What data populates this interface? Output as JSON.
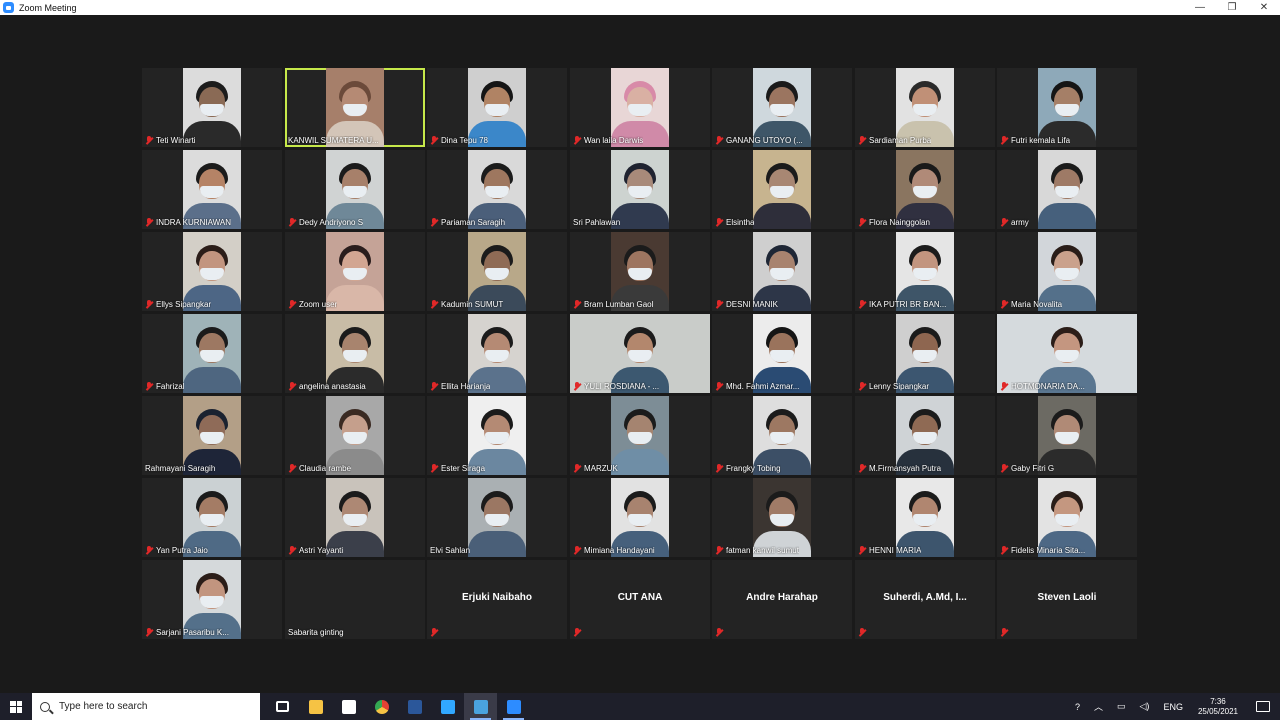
{
  "window": {
    "title": "Zoom Meeting",
    "minimize": "—",
    "maximize": "❐",
    "close": "✕"
  },
  "participants": [
    {
      "name": "Teti Winarti",
      "muted": true,
      "video": true,
      "bg": "#dcdcdc",
      "skin": "#8a6a55",
      "hair": "#1c1c1c",
      "body": "#2a2a2a"
    },
    {
      "name": "KANWIL SUMATERA U...",
      "muted": false,
      "video": true,
      "active": true,
      "bg": "#a67f6a",
      "skin": "#b58a74",
      "hair": "#6b4a3a",
      "body": "#d3c5b8"
    },
    {
      "name": "Dina Tepu 78",
      "muted": true,
      "video": true,
      "bg": "#cfcfcf",
      "skin": "#b08364",
      "hair": "#151515",
      "body": "#3b87c9"
    },
    {
      "name": "Wan laila Darwis",
      "muted": true,
      "video": true,
      "bg": "#e8d6d6",
      "skin": "#d9b0a3",
      "hair": "#d88aa8",
      "body": "#d08aa8"
    },
    {
      "name": "GANANG UTOYO (...",
      "muted": true,
      "video": true,
      "bg": "#cfd8dd",
      "skin": "#9b7560",
      "hair": "#1a1a1a",
      "body": "#3e5668"
    },
    {
      "name": "Sardiaman Purba",
      "muted": true,
      "video": true,
      "bg": "#e2e2e2",
      "skin": "#c09077",
      "hair": "#2a2a2a",
      "body": "#c9c2ad"
    },
    {
      "name": "Futri kemala Lifa",
      "muted": true,
      "video": true,
      "bg": "#8ea9b9",
      "skin": "#a57f67",
      "hair": "#151515",
      "body": "#2b2b2b"
    },
    {
      "name": "INDRA KURNIAWAN",
      "muted": true,
      "video": true,
      "bg": "#dcdcdc",
      "skin": "#b58366",
      "hair": "#1b1b1b",
      "body": "#5b6f8a"
    },
    {
      "name": "Dedy Andriyono S",
      "muted": true,
      "video": true,
      "bg": "#d0d3d3",
      "skin": "#a7806a",
      "hair": "#1b1b1b",
      "body": "#6f8898"
    },
    {
      "name": "Pariaman Saragih",
      "muted": true,
      "video": true,
      "bg": "#d9d9d9",
      "skin": "#9e775f",
      "hair": "#1b1b1b",
      "body": "#4b5f7a"
    },
    {
      "name": "Sri Pahlawan",
      "muted": false,
      "video": true,
      "bg": "#cdd3d0",
      "skin": "#a88a7a",
      "hair": "#1f2330",
      "body": "#303a4f"
    },
    {
      "name": "Elsintha",
      "muted": true,
      "video": true,
      "bg": "#c7b48f",
      "skin": "#a88773",
      "hair": "#1b1b1b",
      "body": "#2e2e3a"
    },
    {
      "name": "Flora Nainggolan",
      "muted": true,
      "video": true,
      "bg": "#8a7560",
      "skin": "#b08a78",
      "hair": "#1a1a1a",
      "body": "#303040"
    },
    {
      "name": "army",
      "muted": true,
      "video": true,
      "bg": "#d8d8d8",
      "skin": "#9e7a66",
      "hair": "#1b1b1b",
      "body": "#46607c"
    },
    {
      "name": "Ellys Sipangkar",
      "muted": true,
      "video": true,
      "bg": "#d3cfc7",
      "skin": "#c2957f",
      "hair": "#2b1d18",
      "body": "#4d6685"
    },
    {
      "name": "Zoom user",
      "muted": true,
      "video": true,
      "bg": "#c5a397",
      "skin": "#d2a692",
      "hair": "#2a1d1c",
      "body": "#d9b7a8"
    },
    {
      "name": "Kadumin SUMUT",
      "muted": true,
      "video": true,
      "bg": "#b8a889",
      "skin": "#8f6b55",
      "hair": "#1b1b1b",
      "body": "#3b4a5a"
    },
    {
      "name": "Bram Lumban Gaol",
      "muted": true,
      "video": true,
      "bg": "#4a3a32",
      "skin": "#9d7560",
      "hair": "#1b1b1b",
      "body": "#3a3a3a"
    },
    {
      "name": "DESNI MANIK",
      "muted": true,
      "video": true,
      "bg": "#cfcfcf",
      "skin": "#a8836f",
      "hair": "#1e2635",
      "body": "#2d3648"
    },
    {
      "name": "IKA PUTRI BR BAN...",
      "muted": true,
      "video": true,
      "bg": "#e5e5e5",
      "skin": "#c2957f",
      "hair": "#1b1b1b",
      "body": "#3e5568"
    },
    {
      "name": "Maria Novalita",
      "muted": true,
      "video": true,
      "bg": "#d2d6da",
      "skin": "#caa18c",
      "hair": "#2a1d18",
      "body": "#54708a"
    },
    {
      "name": "Fahrizal",
      "muted": true,
      "video": true,
      "bg": "#9fb3b8",
      "skin": "#9d7862",
      "hair": "#1b1b1b",
      "body": "#4e6680"
    },
    {
      "name": "angelina anastasia",
      "muted": true,
      "video": true,
      "bg": "#c8bca6",
      "skin": "#a8846e",
      "hair": "#1b1b1b",
      "body": "#2b2b2b"
    },
    {
      "name": "Ellita Harianja",
      "muted": true,
      "video": true,
      "bg": "#d6d3cf",
      "skin": "#b58a74",
      "hair": "#1b1b1b",
      "body": "#5b728c"
    },
    {
      "name": "YULI ROSDIANA - ...",
      "muted": true,
      "video": true,
      "wide": true,
      "bg": "#c9ccc9",
      "skin": "#b3876d",
      "hair": "#1b1b1b",
      "body": "#3c5870"
    },
    {
      "name": "Mhd. Fahmi Azmar...",
      "muted": true,
      "video": true,
      "bg": "#ececec",
      "skin": "#9a735c",
      "hair": "#151515",
      "body": "#2a4b73"
    },
    {
      "name": "Lenny Sipangkar",
      "muted": true,
      "video": true,
      "bg": "#cfcfcf",
      "skin": "#8e6650",
      "hair": "#1b1b1b",
      "body": "#3c5670"
    },
    {
      "name": "HOTMONARIA DA...",
      "muted": true,
      "video": true,
      "wide": true,
      "bg": "#d5dadd",
      "skin": "#c49680",
      "hair": "#2b1d18",
      "body": "#5a7690"
    },
    {
      "name": "Rahmayani Saragih",
      "muted": false,
      "video": true,
      "bg": "#b39f87",
      "skin": "#8f6b58",
      "hair": "#1b2230",
      "body": "#1e2538"
    },
    {
      "name": "Claudia rambe",
      "muted": true,
      "video": true,
      "bg": "#a8a8a8",
      "skin": "#c59f8c",
      "hair": "#3a2a22",
      "body": "#8b8b8b"
    },
    {
      "name": "Ester Siraga",
      "muted": true,
      "video": true,
      "bg": "#efefef",
      "skin": "#b48a74",
      "hair": "#1b1b1b",
      "body": "#6b87a0"
    },
    {
      "name": "MARZUK",
      "muted": true,
      "video": true,
      "bg": "#7d8d96",
      "skin": "#a58470",
      "hair": "#1b1b1b",
      "body": "#6f8ea6"
    },
    {
      "name": "Frangky Tobing",
      "muted": true,
      "video": true,
      "bg": "#dedede",
      "skin": "#9d7862",
      "hair": "#1b1b1b",
      "body": "#3c4f66"
    },
    {
      "name": "M.Firmansyah Putra",
      "muted": true,
      "video": true,
      "bg": "#cfd3d6",
      "skin": "#8f6a54",
      "hair": "#1b1b1b",
      "body": "#27313d"
    },
    {
      "name": "Gaby Fitri G",
      "muted": true,
      "video": true,
      "bg": "#6c6a63",
      "skin": "#b08a76",
      "hair": "#1b1b1b",
      "body": "#2b2b2b"
    },
    {
      "name": "Yan Putra Jaio",
      "muted": true,
      "video": true,
      "bg": "#cbd1d3",
      "skin": "#a47c65",
      "hair": "#1b1b1b",
      "body": "#4f6a85"
    },
    {
      "name": "Astri Yayanti",
      "muted": true,
      "video": true,
      "bg": "#c9c3bb",
      "skin": "#ad8874",
      "hair": "#1b1b1b",
      "body": "#3b3f4a"
    },
    {
      "name": "Elvi Sahlan",
      "muted": false,
      "video": true,
      "bg": "#aab0b3",
      "skin": "#9b7763",
      "hair": "#1b1b1b",
      "body": "#4a5f78"
    },
    {
      "name": "Mimiana Handayani",
      "muted": true,
      "video": true,
      "bg": "#e2e2e2",
      "skin": "#a8836f",
      "hair": "#1b1b1b",
      "body": "#46607c"
    },
    {
      "name": "fatman kanwil sumut",
      "muted": true,
      "video": true,
      "bg": "#3b3531",
      "skin": "#a07b67",
      "hair": "#1b1b1b",
      "body": "#cfd3d6"
    },
    {
      "name": "HENNI MARIA",
      "muted": true,
      "video": true,
      "bg": "#e8e8e8",
      "skin": "#b08670",
      "hair": "#1b1b1b",
      "body": "#3d556d"
    },
    {
      "name": "Fidelis Minaria Sita...",
      "muted": true,
      "video": true,
      "bg": "#e3e3e3",
      "skin": "#c49780",
      "hair": "#2a1d18",
      "body": "#4d6885"
    },
    {
      "name": "Sarjani Pasaribu K...",
      "muted": true,
      "video": true,
      "bg": "#d5d9db",
      "skin": "#c2957f",
      "hair": "#2b1d18",
      "body": "#54708a"
    },
    {
      "name": "Sabarita ginting",
      "muted": false,
      "video": false
    },
    {
      "name": "Erjuki Naibaho",
      "muted": true,
      "video": false,
      "display_name": "Erjuki Naibaho"
    },
    {
      "name": "CUT ANA",
      "muted": true,
      "video": false,
      "display_name": "CUT ANA"
    },
    {
      "name": "Andre Harahap",
      "muted": true,
      "video": false,
      "display_name": "Andre Harahap"
    },
    {
      "name": "Suherdi, A.Md, I...",
      "muted": true,
      "video": false,
      "display_name": "Suherdi, A.Md, I..."
    },
    {
      "name": "Steven Laoli",
      "muted": true,
      "video": false,
      "display_name": "Steven Laoli"
    }
  ],
  "taskbar": {
    "search_placeholder": "Type here to search",
    "apps": [
      {
        "icon": "task-view-icon",
        "color": "#ffffff"
      },
      {
        "icon": "file-explorer-icon",
        "color": "#f6c344"
      },
      {
        "icon": "dropbox-icon",
        "color": "#ffffff"
      },
      {
        "icon": "chrome-icon",
        "color": "#e44134"
      },
      {
        "icon": "word-icon",
        "color": "#2b579a"
      },
      {
        "icon": "photoshop-icon",
        "color": "#31a8ff"
      },
      {
        "icon": "media-icon",
        "color": "#4aa3df"
      },
      {
        "icon": "zoom-icon",
        "color": "#2d8cff"
      }
    ],
    "language": "ENG",
    "time": "7:36",
    "date": "25/05/2021"
  }
}
